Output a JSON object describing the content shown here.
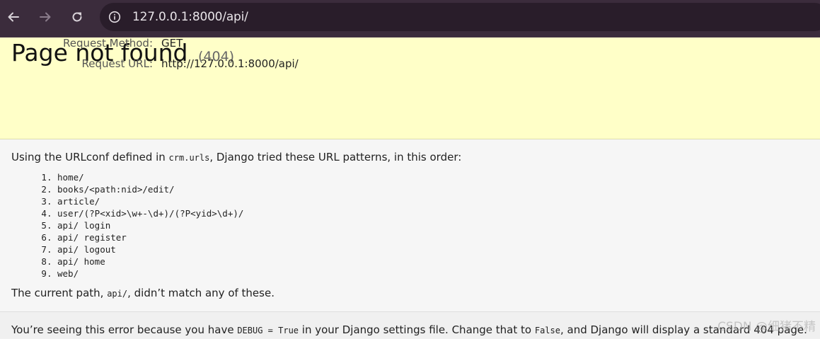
{
  "browser": {
    "url": "127.0.0.1:8000/api/",
    "back_icon": "arrow-left-icon",
    "forward_icon": "arrow-right-icon",
    "reload_icon": "reload-icon",
    "site_info_icon": "info-icon",
    "toolbar_color": "#3b2c3c"
  },
  "summary": {
    "title": "Page not found",
    "status_code": "(404)",
    "request_method_label": "Request Method:",
    "request_method_value": "GET",
    "request_url_label": "Request URL:",
    "request_url_value": "http://127.0.0.1:8000/api/",
    "background_color": "#ffffc8"
  },
  "info": {
    "intro_prefix": "Using the URLconf defined in ",
    "urlconf": "crm.urls",
    "intro_suffix": ", Django tried these URL patterns, in this order:",
    "patterns": [
      "home/",
      "books/<path:nid>/edit/",
      "article/",
      "user/(?P<xid>\\w+-\\d+)/(?P<yid>\\d+)/",
      "api/ login",
      "api/ register",
      "api/ logout",
      "api/ home",
      "web/"
    ],
    "outro_prefix": "The current path, ",
    "current_path": "api/",
    "outro_suffix": ", didn’t match any of these."
  },
  "explanation": {
    "prefix": "You’re seeing this error because you have ",
    "debug_setting": "DEBUG = True",
    "middle": " in your Django settings file. Change that to ",
    "false_value": "False",
    "suffix": ", and Django will display a standard 404 page."
  },
  "watermark": "CSDN @细猪不精"
}
